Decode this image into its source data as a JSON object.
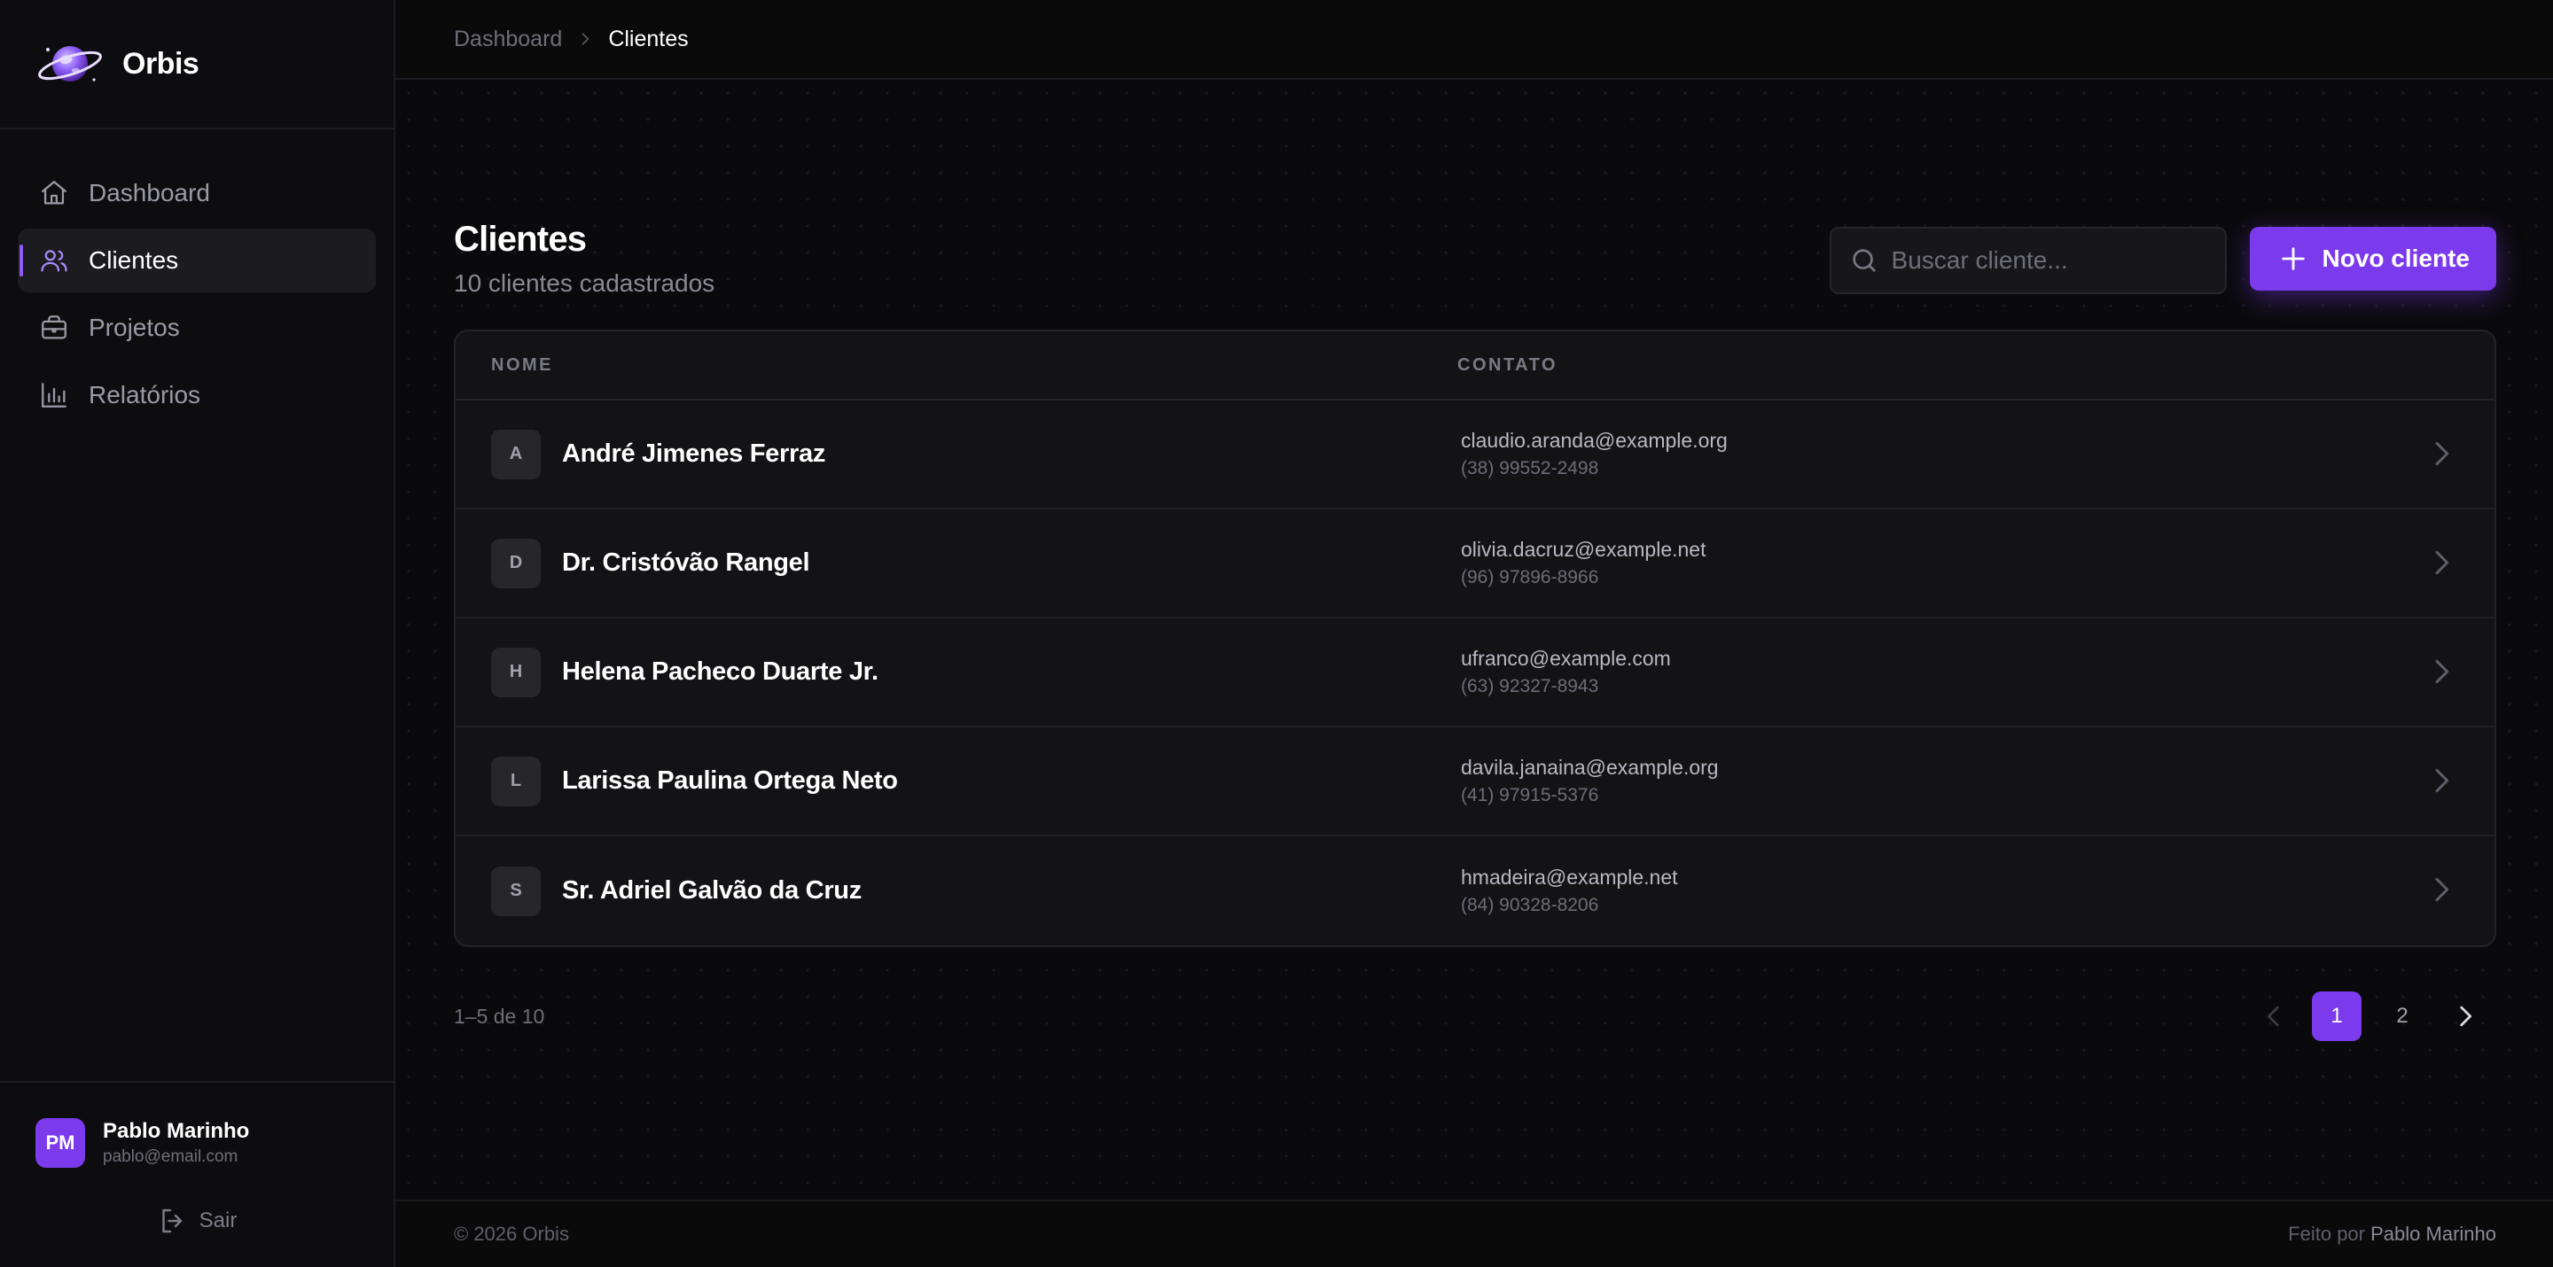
{
  "brand": {
    "name": "Orbis"
  },
  "nav": [
    {
      "label": "Dashboard",
      "icon": "home-icon",
      "active": false
    },
    {
      "label": "Clientes",
      "icon": "users-icon",
      "active": true
    },
    {
      "label": "Projetos",
      "icon": "briefcase-icon",
      "active": false
    },
    {
      "label": "Relatórios",
      "icon": "bar-chart-icon",
      "active": false
    }
  ],
  "user": {
    "initials": "PM",
    "name": "Pablo Marinho",
    "email": "pablo@email.com",
    "logout_label": "Sair"
  },
  "breadcrumb": {
    "parent": "Dashboard",
    "current": "Clientes"
  },
  "page": {
    "title": "Clientes",
    "subtitle": "10 clientes cadastrados",
    "search_placeholder": "Buscar cliente...",
    "new_button": "Novo cliente"
  },
  "table": {
    "columns": {
      "name": "NOME",
      "contact": "CONTATO"
    },
    "rows": [
      {
        "initial": "A",
        "name": "André Jimenes Ferraz",
        "email": "claudio.aranda@example.org",
        "phone": "(38) 99552-2498"
      },
      {
        "initial": "D",
        "name": "Dr. Cristóvão Rangel",
        "email": "olivia.dacruz@example.net",
        "phone": "(96) 97896-8966"
      },
      {
        "initial": "H",
        "name": "Helena Pacheco Duarte Jr.",
        "email": "ufranco@example.com",
        "phone": "(63) 92327-8943"
      },
      {
        "initial": "L",
        "name": "Larissa Paulina Ortega Neto",
        "email": "davila.janaina@example.org",
        "phone": "(41) 97915-5376"
      },
      {
        "initial": "S",
        "name": "Sr. Adriel Galvão da Cruz",
        "email": "hmadeira@example.net",
        "phone": "(84) 90328-8206"
      }
    ]
  },
  "pagination": {
    "range": "1–5 de 10",
    "pages": [
      "1",
      "2"
    ],
    "current": "1"
  },
  "footer": {
    "copyright": "© 2026 Orbis",
    "made_by": "Feito por",
    "author": "Pablo Marinho"
  },
  "colors": {
    "accent": "#7c3aed",
    "background": "#0a0a0c",
    "panel": "#131316"
  }
}
